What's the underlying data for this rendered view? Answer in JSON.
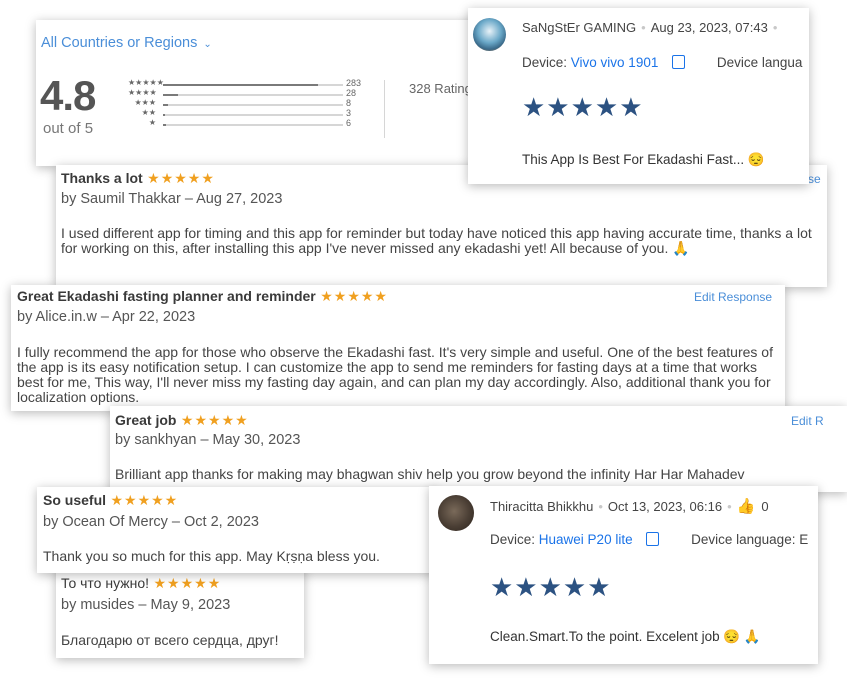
{
  "summary": {
    "region_label": "All Countries or Regions",
    "chevron_icon": "chevron-down-icon",
    "rating": "4.8",
    "out_of": "out of 5",
    "ratings_count_label": "328 Ratings",
    "bars": [
      {
        "stars": "★★★★★",
        "count": "283",
        "fraction": 0.86
      },
      {
        "stars": "★★★★",
        "count": "28",
        "fraction": 0.085
      },
      {
        "stars": "★★★",
        "count": "8",
        "fraction": 0.025
      },
      {
        "stars": "★★",
        "count": "3",
        "fraction": 0.01
      },
      {
        "stars": "★",
        "count": "6",
        "fraction": 0.018
      }
    ]
  },
  "gp_review_1": {
    "name": "SaNgStEr GAMING",
    "date": "Aug 23, 2023, 07:43",
    "device_label": "Device:",
    "device_value": "Vivo vivo 1901",
    "language_label": "Device langua",
    "stars": "★★★★★",
    "text": "This App Is Best For Ekadashi Fast... 😔"
  },
  "review_saumil": {
    "title": "Thanks a lot",
    "stars": "★★★★★",
    "byline": "by Saumil Thakkar – Aug 27, 2023",
    "edit_label": "se",
    "body": "I used different app for timing and this app for reminder but today have noticed this app having accurate time, thanks a lot for working on this, after installing this app I've never missed any ekadashi yet! All because of you. 🙏"
  },
  "review_alice": {
    "title": "Great Ekadashi fasting planner and reminder",
    "stars": "★★★★★",
    "byline": "by Alice.in.w – Apr 22, 2023",
    "edit_label": "Edit Response",
    "body": "I fully recommend the app for those who observe the Ekadashi fast. It's very simple and useful. One of the best features of the app is its easy notification setup. I can customize the app to send me reminders for fasting days at a time that works best for me, This way, I'll never miss my fasting day again, and can plan my day accordingly. Also, additional thank you for localization options."
  },
  "review_sankhyan": {
    "title": "Great job",
    "stars": "★★★★★",
    "byline": "by sankhyan – May 30, 2023",
    "edit_label": "Edit R",
    "body": "Brilliant app thanks for making may bhagwan shiv help you grow beyond the infinity Har Har Mahadev"
  },
  "review_ocean": {
    "title": "So useful",
    "stars": "★★★★★",
    "byline": "by Ocean Of Mercy – Oct 2, 2023",
    "body": "Thank you so much for this app. May Kṛṣṇa bless you."
  },
  "review_musides": {
    "title": "То что нужно!",
    "stars": "★★★★★",
    "byline": "by musides – May 9, 2023",
    "body": "Благодарю от всего сердца, друг!"
  },
  "gp_review_2": {
    "name": "Thiracitta Bhikkhu",
    "date": "Oct 13, 2023, 06:16",
    "like_count": "0",
    "like_icon": "thumbs-up-icon",
    "device_label": "Device:",
    "device_value": "Huawei P20 lite",
    "language_label": "Device language: E",
    "stars": "★★★★★",
    "text": "Clean.Smart.To the point. Excelent job 😔 🙏"
  },
  "colors": {
    "link_blue": "#1a73e8",
    "appstore_link": "#4a8ed8",
    "star_orange": "#f0a020",
    "gp_star_blue": "#2c5282"
  }
}
